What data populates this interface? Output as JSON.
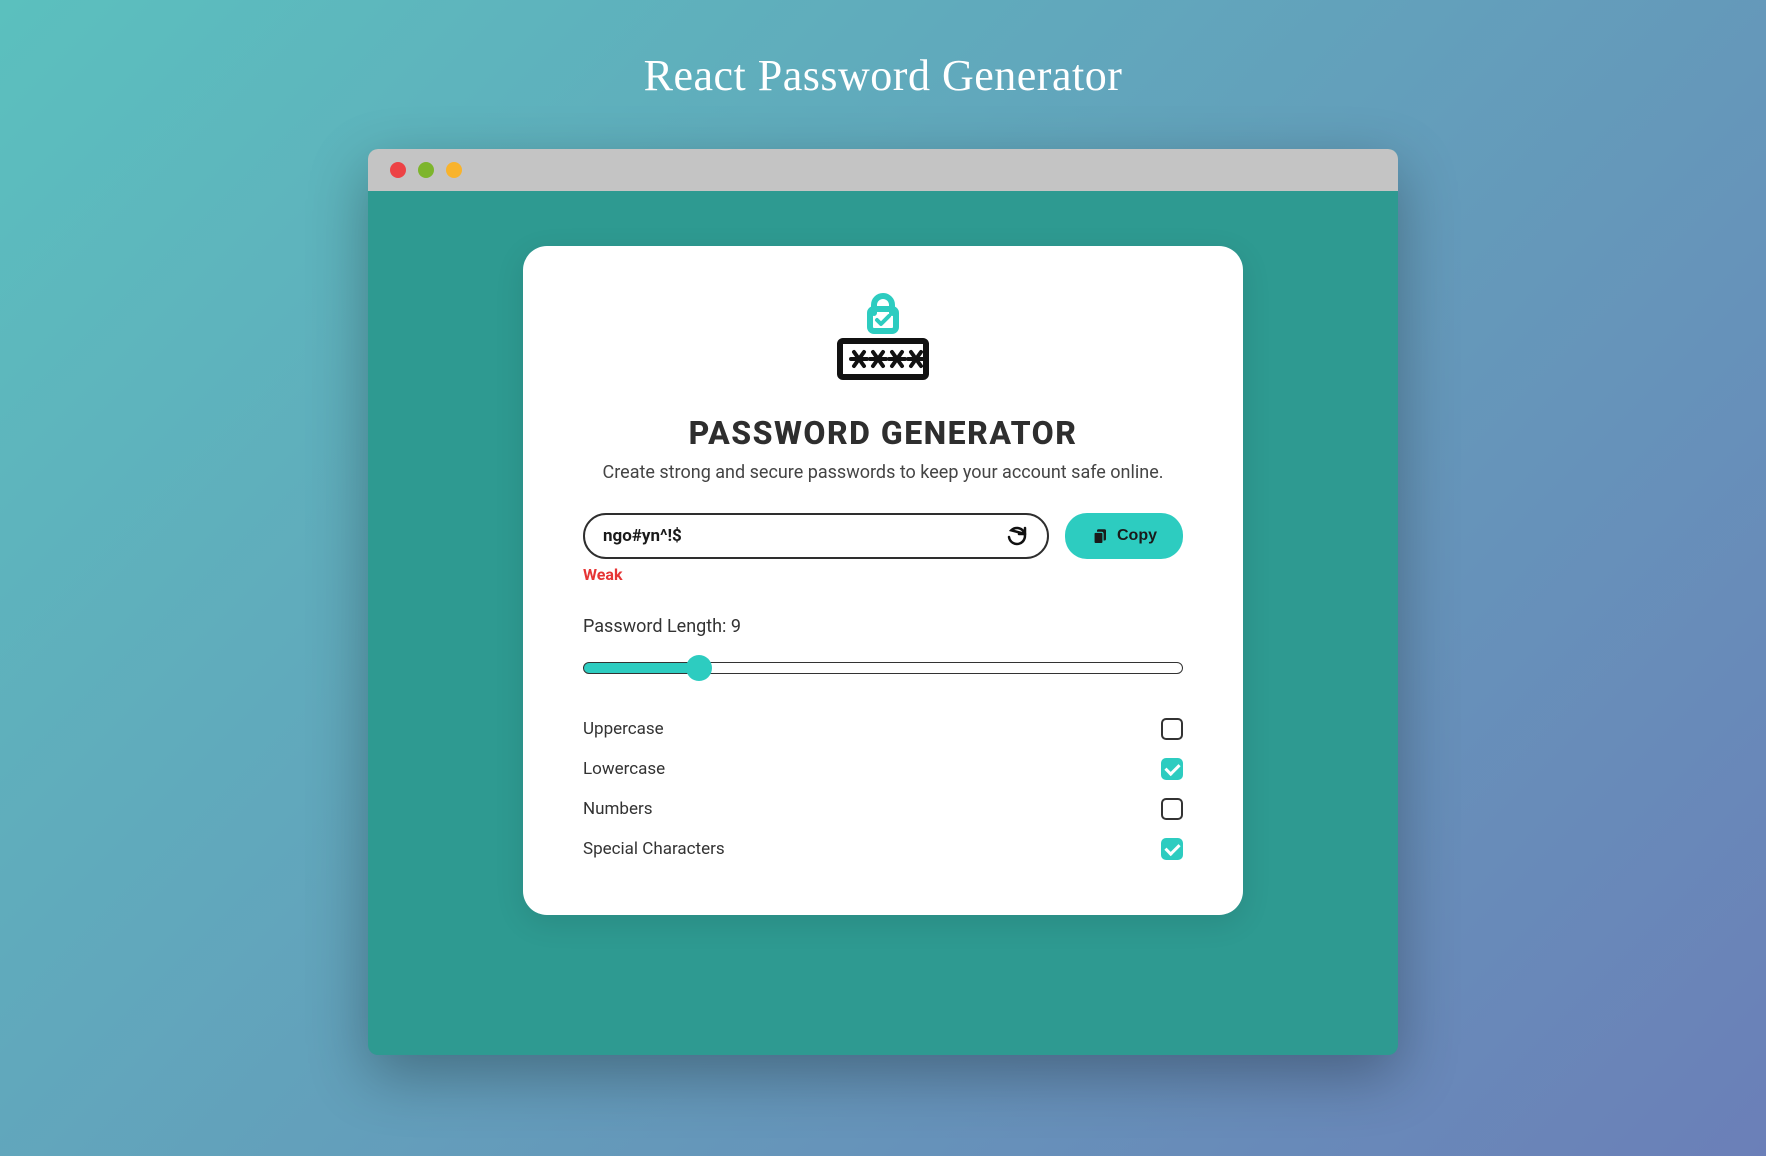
{
  "page": {
    "title": "React Password Generator"
  },
  "card": {
    "title": "PASSWORD GENERATOR",
    "subtitle": "Create strong and secure passwords to keep your account safe online."
  },
  "password": {
    "value": "ngo#yn^!$",
    "strength": "Weak",
    "strength_color": "#e63535"
  },
  "copy": {
    "label": "Copy"
  },
  "length": {
    "label_prefix": "Password Length: ",
    "value": 9,
    "min": 4,
    "max": 32
  },
  "options": [
    {
      "label": "Uppercase",
      "checked": false
    },
    {
      "label": "Lowercase",
      "checked": true
    },
    {
      "label": "Numbers",
      "checked": false
    },
    {
      "label": "Special Characters",
      "checked": true
    }
  ],
  "colors": {
    "accent": "#2dccc0",
    "app_bg": "#2e9a91"
  }
}
